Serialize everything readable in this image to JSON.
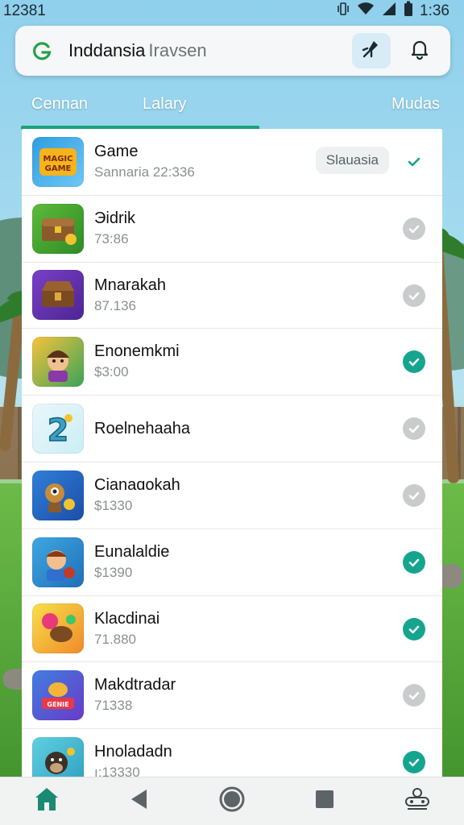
{
  "status_bar": {
    "time_left": "12381",
    "time_right": "1:36"
  },
  "search": {
    "query": "Inddansia",
    "suggestion": "Iravsen"
  },
  "tabs": [
    {
      "label": "Cennan"
    },
    {
      "label": "Lalary"
    },
    {
      "label": "Mudas"
    }
  ],
  "apps": [
    {
      "name": "Game",
      "subtitle": "Sannaria 22:336",
      "badge": "Slauasia",
      "checked": true,
      "icon": "game-logo-icon"
    },
    {
      "name": "Эidrik",
      "subtitle": "73:86",
      "checked": false,
      "icon": "treasure-chest-icon"
    },
    {
      "name": "Mnarakah",
      "subtitle": "87.136",
      "checked": false,
      "icon": "treasure-box-icon"
    },
    {
      "name": "Enonemkmi",
      "subtitle": "$3:00",
      "checked": true,
      "icon": "character-icon"
    },
    {
      "name": "Roelnehaaha",
      "subtitle": "",
      "checked": false,
      "icon": "number-two-icon"
    },
    {
      "name": "Cianaɑokah",
      "subtitle": "$1330",
      "checked": false,
      "icon": "robot-character-icon"
    },
    {
      "name": "Eunalaldie",
      "subtitle": "$1390",
      "checked": true,
      "icon": "hero-character-icon"
    },
    {
      "name": "Klacdinai",
      "subtitle": "71.880",
      "checked": true,
      "icon": "slingshot-icon"
    },
    {
      "name": "Makdtradar",
      "subtitle": "71338",
      "checked": false,
      "icon": "genie-icon"
    },
    {
      "name": "Hnoladadn",
      "subtitle": "ı:13330",
      "checked": true,
      "icon": "monkey-icon"
    }
  ],
  "colors": {
    "accent": "#15a58f",
    "tab_indicator": "#1aa27a",
    "search_icon": "#24a148"
  },
  "nav": [
    {
      "icon": "home-icon"
    },
    {
      "icon": "back-icon"
    },
    {
      "icon": "home-circle-icon"
    },
    {
      "icon": "recents-icon"
    },
    {
      "icon": "assistant-icon"
    }
  ]
}
